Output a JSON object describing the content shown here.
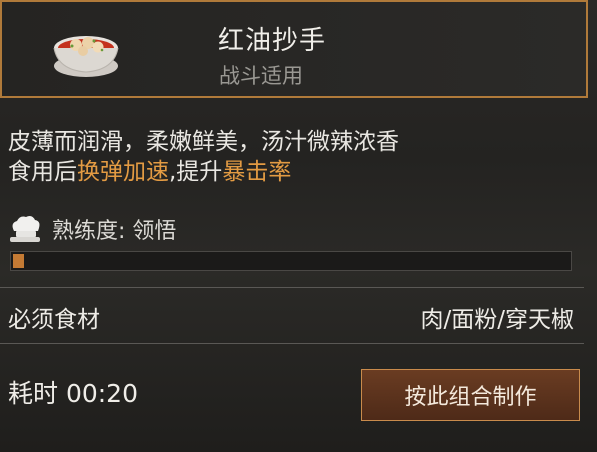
{
  "dish": {
    "name": "红油抄手",
    "tag": "战斗适用",
    "icon": "chili-oil-wonton-bowl-icon"
  },
  "description": {
    "line1": "皮薄而润滑，柔嫩鲜美，汤汁微辣浓香",
    "line2_prefix": "食用后",
    "line2_effect1": "换弹加速",
    "line2_sep": ",提升",
    "line2_effect2": "暴击率"
  },
  "proficiency": {
    "label": "熟练度: 领悟",
    "icon": "chef-hat-icon",
    "progress": 0.02
  },
  "ingredients": {
    "label": "必须食材",
    "value": "肉/面粉/穿天椒"
  },
  "time": {
    "label": "耗时 00:20"
  },
  "actions": {
    "make_label": "按此组合制作"
  },
  "colors": {
    "accent": "#e39b43",
    "border": "#b07a3a",
    "button": "#5a3320"
  }
}
